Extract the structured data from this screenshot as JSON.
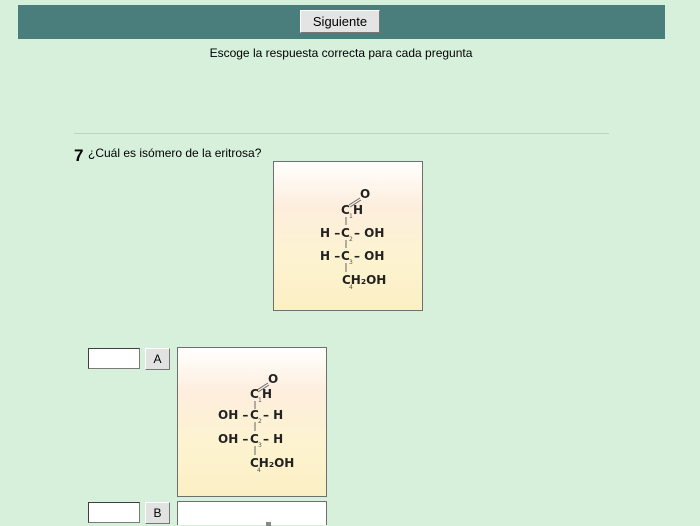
{
  "toolbar": {
    "next_label": "Siguiente"
  },
  "instructions": "Escoge la respuesta correcta para cada pregunta",
  "question": {
    "number": "7",
    "text": "¿Cuál es isómero de la eritrosa?",
    "molecule": {
      "aldehyde_o": "O",
      "c1": "C",
      "c1_h": "H",
      "row2_left": "H –",
      "c2": "C",
      "row2_right": "– OH",
      "row3_left": "H –",
      "c3": "C",
      "row3_right": "– OH",
      "c4": "CH₂OH"
    }
  },
  "options": [
    {
      "letter": "A",
      "input_value": "",
      "molecule": {
        "aldehyde_o": "O",
        "c1": "C",
        "c1_h": "H",
        "row2_left": "OH –",
        "c2": "C",
        "row2_right": "– H",
        "row3_left": "OH –",
        "c3": "C",
        "row3_right": "– H",
        "c4": "CH₂OH"
      }
    },
    {
      "letter": "B",
      "input_value": ""
    }
  ]
}
